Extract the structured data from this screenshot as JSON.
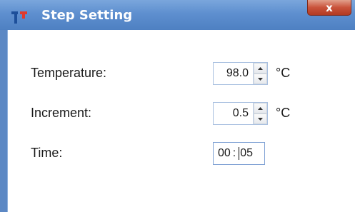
{
  "window": {
    "title": "Step Setting",
    "close_label": "x"
  },
  "fields": {
    "temperature": {
      "label": "Temperature:",
      "value": "98.0",
      "unit": "°C"
    },
    "increment": {
      "label": "Increment:",
      "value": "0.5",
      "unit": "°C"
    },
    "time": {
      "label": "Time:",
      "hours": "00",
      "separator": ":",
      "minutes": "05"
    }
  },
  "icons": {
    "app": "app-logo-icon",
    "spin_up": "spin-up-arrow-icon",
    "spin_down": "spin-down-arrow-icon"
  },
  "colors": {
    "titlebar": "#5e8fcf",
    "close_button": "#c9533b",
    "logo_blue": "#1d4f9a",
    "logo_red": "#e03a2c"
  }
}
